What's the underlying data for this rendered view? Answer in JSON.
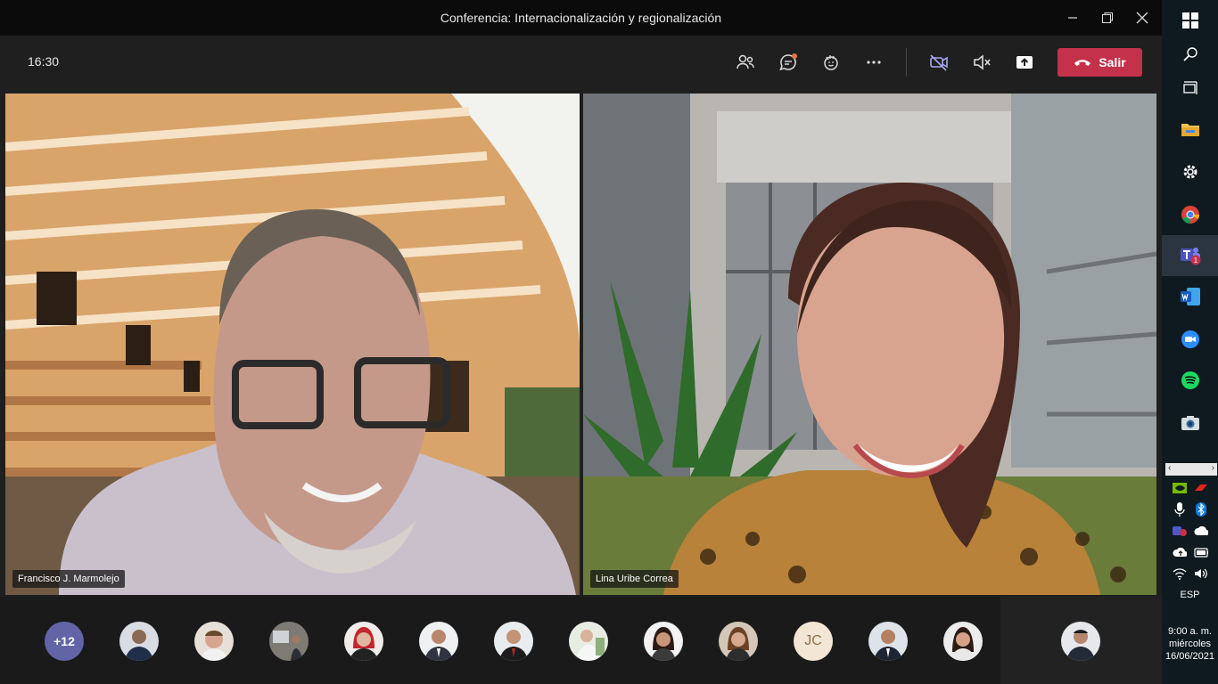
{
  "window": {
    "title": "Conferencia: Internacionalización y regionalización"
  },
  "toolbar": {
    "time": "16:30",
    "participants_icon": "people-icon",
    "chat_icon": "chat-icon",
    "reactions_icon": "raise-hand-icon",
    "more_icon": "more-options-icon",
    "camera_icon": "camera-off-icon",
    "mic_icon": "mic-muted-icon",
    "share_icon": "share-screen-icon",
    "leave_label": "Salir"
  },
  "videos": [
    {
      "name": "Francisco J. Marmolejo"
    },
    {
      "name": "Lina Uribe Correa"
    }
  ],
  "participants_strip": {
    "more_count": "+12",
    "initials_avatar": "JC"
  },
  "taskbar": {
    "teams_badge": "1",
    "language": "ESP",
    "clock_time": "9:00 a. m.",
    "clock_day": "miércoles",
    "clock_date": "16/06/2021"
  },
  "colors": {
    "leave": "#c4314b",
    "accent": "#6264a7",
    "chat_dot": "#e97548"
  }
}
